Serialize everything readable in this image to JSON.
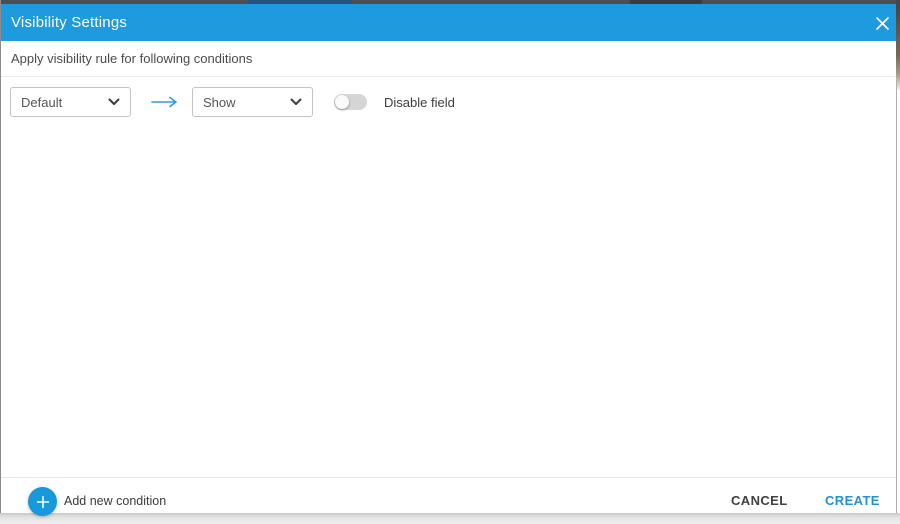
{
  "dialog": {
    "title": "Visibility Settings",
    "subtitle": "Apply visibility rule for following conditions",
    "condition_row": {
      "field_dropdown": {
        "value": "Default"
      },
      "action_dropdown": {
        "value": "Show"
      },
      "toggle": {
        "state": "off",
        "label": "Disable field"
      }
    },
    "footer": {
      "add_button_label": "Add new condition",
      "cancel_label": "CANCEL",
      "create_label": "CREATE"
    }
  },
  "icons": {
    "close": "x-icon",
    "dropdown_chevron": "chevron-down-icon",
    "mapping_arrow": "arrow-right-icon",
    "add": "plus-icon"
  },
  "colors": {
    "header_blue": "#1E9BDE",
    "fab_blue": "#1799DB",
    "arrow_blue": "#2D9BE5",
    "create_blue": "#2490D9",
    "toggle_track": "#D5D5D5"
  }
}
